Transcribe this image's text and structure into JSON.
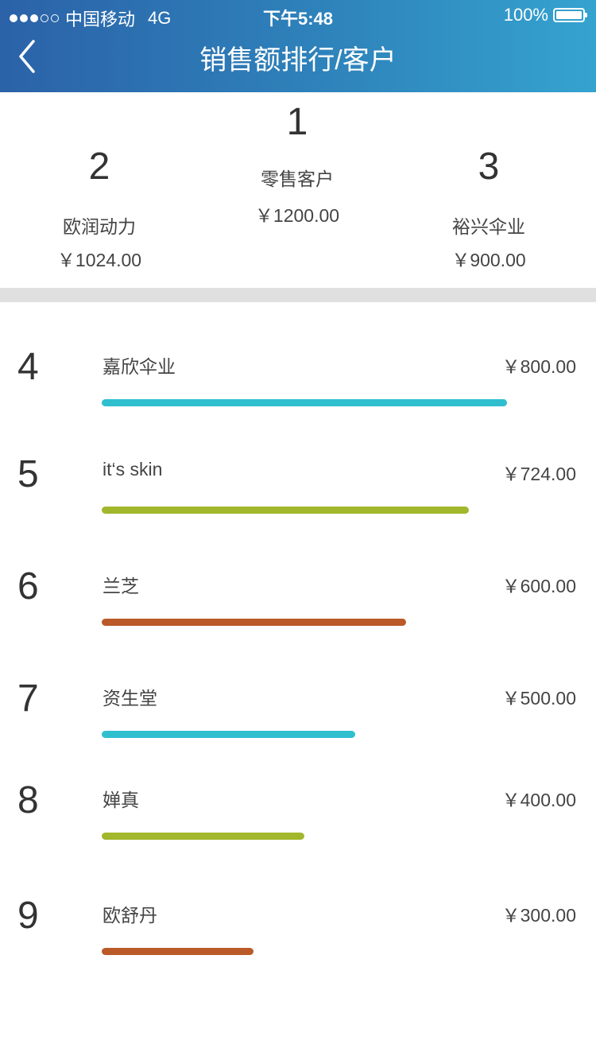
{
  "status_bar": {
    "carrier": "中国移动",
    "network": "4G",
    "time": "下午5:48",
    "battery": "100%"
  },
  "nav": {
    "title": "销售额排行/客户",
    "back_icon": "chevron-left-icon"
  },
  "top3": [
    {
      "rank": "1",
      "name": "零售客户",
      "amount": "￥1200.00"
    },
    {
      "rank": "2",
      "name": "欧润动力",
      "amount": "￥1024.00"
    },
    {
      "rank": "3",
      "name": "裕兴伞业",
      "amount": "￥900.00"
    }
  ],
  "ranking": [
    {
      "rank": "4",
      "name": "嘉欣伞业",
      "amount": "￥800.00",
      "value": 800,
      "color": "#2fbfcf"
    },
    {
      "rank": "5",
      "name": "it‘s skin",
      "amount": "￥724.00",
      "value": 724,
      "color": "#a2b72b"
    },
    {
      "rank": "6",
      "name": "兰芝",
      "amount": "￥600.00",
      "value": 600,
      "color": "#b95a28"
    },
    {
      "rank": "7",
      "name": "资生堂",
      "amount": "￥500.00",
      "value": 500,
      "color": "#2fbfcf"
    },
    {
      "rank": "8",
      "name": "婵真",
      "amount": "￥400.00",
      "value": 400,
      "color": "#a2b72b"
    },
    {
      "rank": "9",
      "name": "欧舒丹",
      "amount": "￥300.00",
      "value": 300,
      "color": "#b95a28"
    }
  ]
}
